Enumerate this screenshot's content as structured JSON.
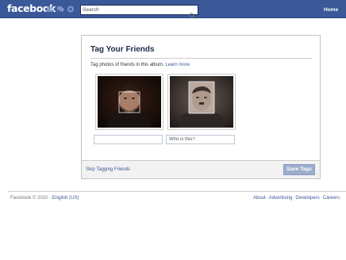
{
  "header": {
    "logo": "facebook",
    "search_placeholder": "Search",
    "nav_home": "Home",
    "icons": [
      "friend-requests-icon",
      "messages-icon",
      "notifications-icon",
      "search-icon"
    ]
  },
  "dialog": {
    "title": "Tag Your Friends",
    "intro_text": "Tag photos of friends in this album.",
    "learn_more": "Learn more",
    "photos": [
      {
        "input_value": "",
        "input_placeholder": ""
      },
      {
        "input_value": "",
        "input_placeholder": "Who is this?"
      }
    ],
    "skip_label": "Skip Tagging Friends",
    "save_label": "Save Tags"
  },
  "footer": {
    "copyright": "Facebook © 2010 ·",
    "language": "English (US)",
    "links": [
      "About",
      "Advertising",
      "Developers",
      "Careers"
    ],
    "separator": "·"
  },
  "colors": {
    "brand_blue": "#3b5998",
    "link": "#3b5998",
    "button_disabled": "#9dadcc"
  }
}
